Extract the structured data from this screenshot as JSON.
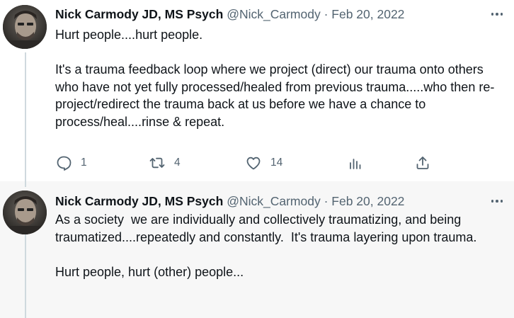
{
  "tweets": [
    {
      "author": {
        "name": "Nick Carmody JD, MS Psych",
        "handle": "@Nick_Carmody",
        "separator": "·",
        "date": "Feb 20, 2022"
      },
      "text": "Hurt people....hurt people.\n\nIt's a trauma feedback loop where we project (direct) our trauma onto others who have not yet fully processed/healed from previous trauma.....who then re-project/redirect the trauma back at us before we have a chance to process/heal....rinse & repeat.",
      "stats": {
        "replies": "1",
        "retweets": "4",
        "likes": "14"
      }
    },
    {
      "author": {
        "name": "Nick Carmody JD, MS Psych",
        "handle": "@Nick_Carmody",
        "separator": "·",
        "date": "Feb 20, 2022"
      },
      "text": "As a society  we are individually and collectively traumatizing, and being traumatized....repeatedly and constantly.  It's trauma layering upon trauma.\n\nHurt people, hurt (other) people..."
    }
  ],
  "icons": {
    "reply": "reply-icon",
    "retweet": "retweet-icon",
    "like": "like-icon",
    "views": "views-icon",
    "share": "share-icon",
    "more": "more-icon"
  },
  "colors": {
    "text": "#0f1419",
    "secondary": "#536471",
    "thread_line": "#cfd9de",
    "highlight_bg": "#f7f7f7"
  }
}
